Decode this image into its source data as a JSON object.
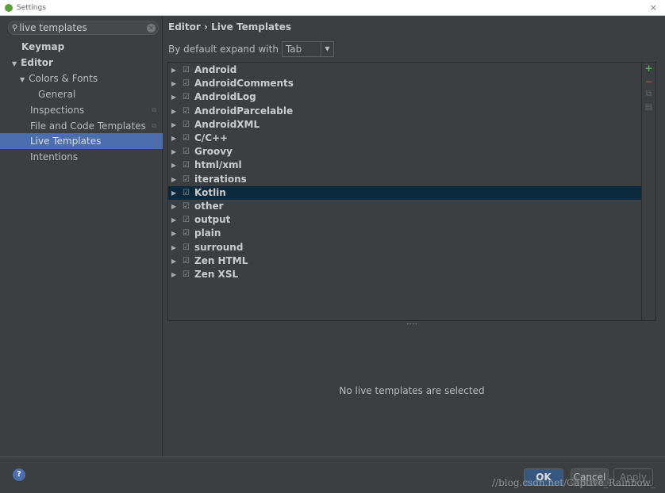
{
  "window": {
    "title": "Settings",
    "close_icon": "×"
  },
  "sidebar": {
    "search_value": "live templates",
    "items": [
      {
        "label": "Keymap",
        "bold": true
      },
      {
        "label": "Editor",
        "bold": true,
        "arrow": "▼"
      },
      {
        "label": "Colors & Fonts",
        "arrow": "▼"
      },
      {
        "label": "General"
      },
      {
        "label": "Inspections"
      },
      {
        "label": "File and Code Templates"
      },
      {
        "label": "Live Templates",
        "selected": true
      },
      {
        "label": "Intentions"
      }
    ]
  },
  "main": {
    "breadcrumb": "Editor › Live Templates",
    "expand_label": "By default expand with",
    "expand_value": "Tab",
    "groups": [
      "Android",
      "AndroidComments",
      "AndroidLog",
      "AndroidParcelable",
      "AndroidXML",
      "C/C++",
      "Groovy",
      "html/xml",
      "iterations",
      "Kotlin",
      "other",
      "output",
      "plain",
      "surround",
      "Zen HTML",
      "Zen XSL"
    ],
    "selected_group": "Kotlin",
    "empty_text": "No live templates are selected"
  },
  "colors": {
    "selection": "#4b6eaf",
    "row_selection": "#0d293e",
    "add": "#4caf50",
    "remove": "#c75450"
  },
  "buttons": {
    "help": "?",
    "ok": "OK",
    "cancel": "Cancel",
    "apply": "Apply"
  },
  "watermark": "//blog.csdn.net/Captive_Rainbow_"
}
